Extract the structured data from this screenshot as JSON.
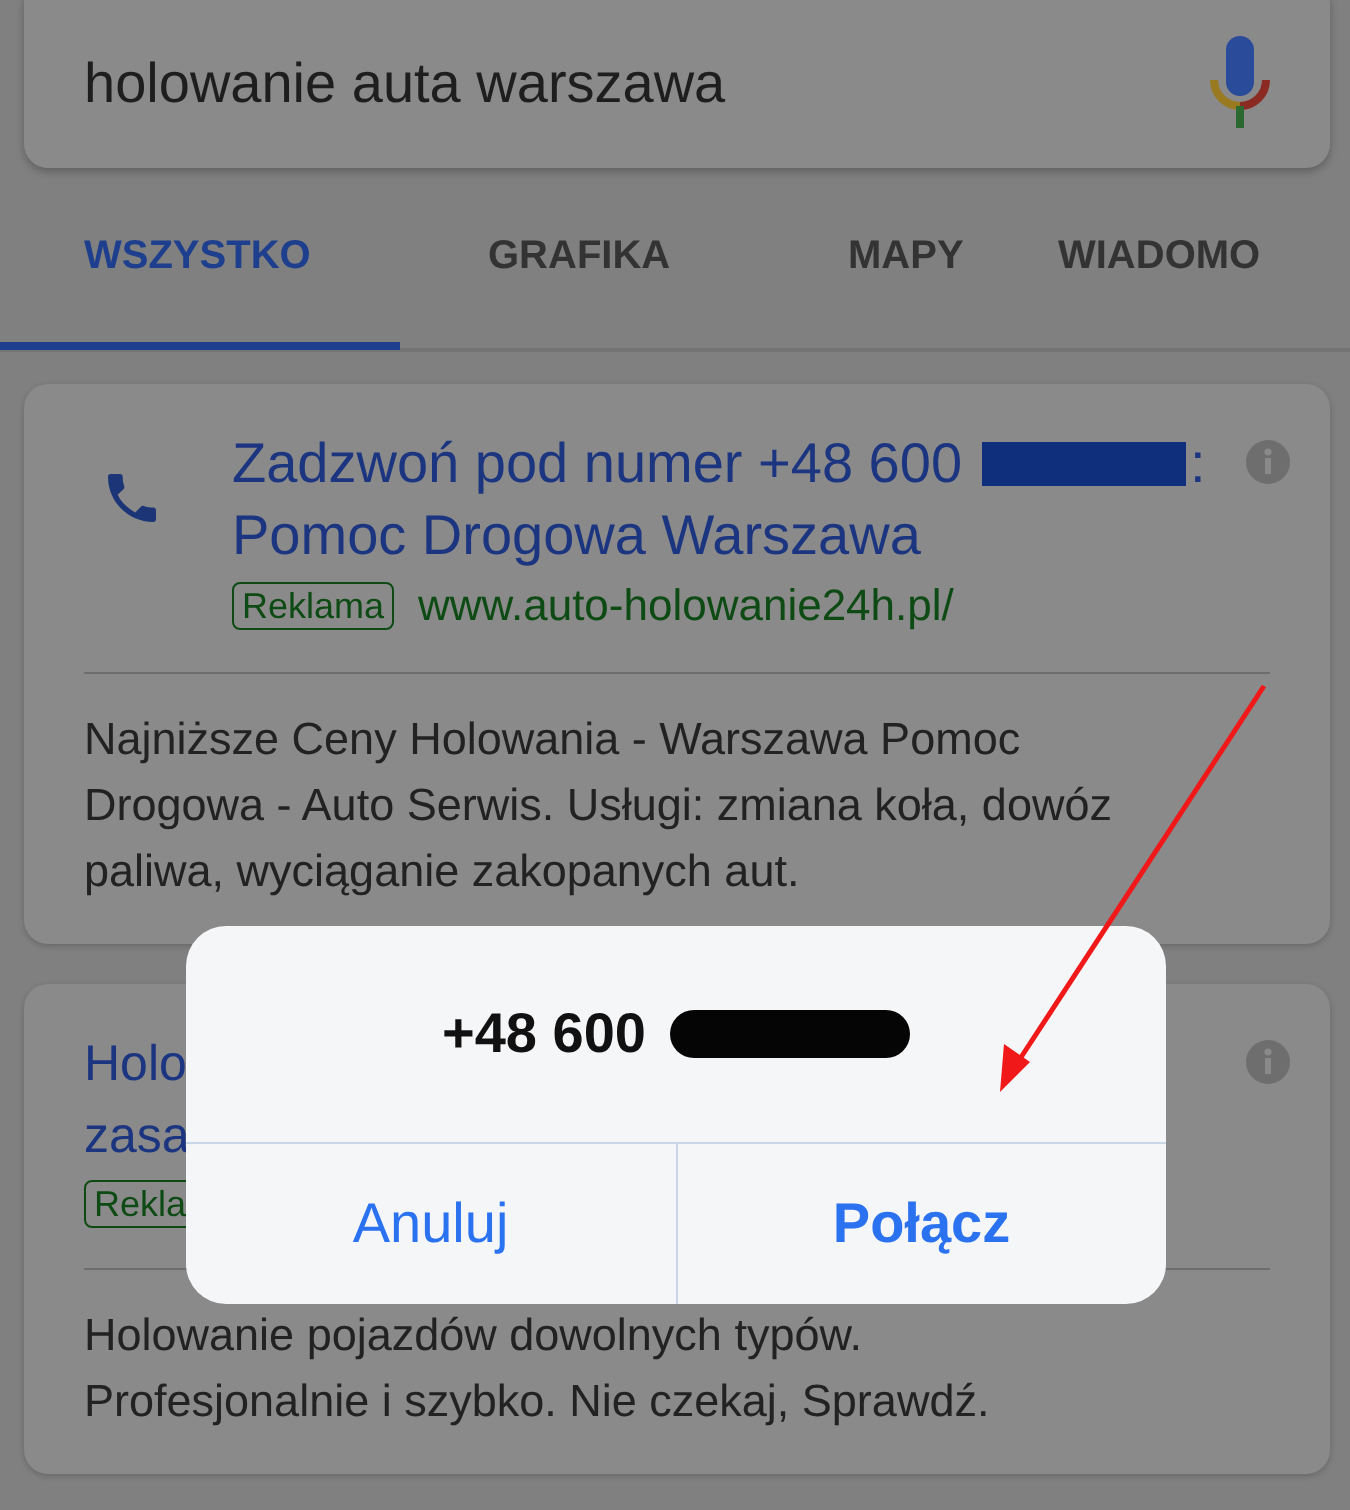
{
  "search": {
    "value": "holowanie auta warszawa"
  },
  "tabs": [
    {
      "label": "WSZYSTKO",
      "selected": true
    },
    {
      "label": "GRAFIKA",
      "selected": false
    },
    {
      "label": "MAPY",
      "selected": false
    },
    {
      "label": "WIADOMO",
      "selected": false
    }
  ],
  "results": [
    {
      "kind": "call",
      "title_prefix": "Zadzwoń pod numer +48 600",
      "title_suffix": ":",
      "title_line_2": "Pomoc Drogowa Warszawa",
      "badge": "Reklama",
      "url": "www.auto-holowanie24h.pl/",
      "description_lines": [
        "Najniższe Ceny Holowania - Warszawa Pomoc",
        "Drogowa - Auto Serwis. Usługi: zmiana koła, dowóz",
        "paliwa, wyciąganie zakopanych aut."
      ]
    },
    {
      "kind": "ad",
      "title_lines": [
        "Holo",
        "zasa"
      ],
      "badge": "Rekla",
      "description_lines": [
        "Holowanie pojazdów dowolnych typów.",
        "Profesjonalnie i szybko. Nie czekaj, Sprawdź."
      ]
    }
  ],
  "dialog": {
    "number": "+48 600",
    "buttons": [
      {
        "label": "Anuluj",
        "kind": "cancel"
      },
      {
        "label": "Połącz",
        "kind": "default"
      }
    ]
  }
}
